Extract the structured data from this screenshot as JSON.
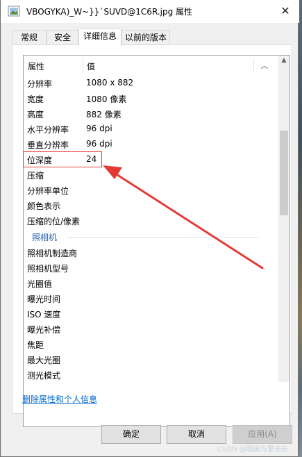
{
  "window": {
    "title": "VBOGYKA)_W~}}`SUVD@1C6R.jpg 属性",
    "close_glyph": "✕"
  },
  "tabs": [
    {
      "label": "常规",
      "active": false
    },
    {
      "label": "安全",
      "active": false
    },
    {
      "label": "详细信息",
      "active": true
    },
    {
      "label": "以前的版本",
      "active": false
    }
  ],
  "list": {
    "header": {
      "property": "属性",
      "value": "值"
    },
    "rows": [
      {
        "name": "分辨率",
        "value": "1080 x 882"
      },
      {
        "name": "宽度",
        "value": "1080 像素"
      },
      {
        "name": "高度",
        "value": "882 像素"
      },
      {
        "name": "水平分辨率",
        "value": "96 dpi"
      },
      {
        "name": "垂直分辨率",
        "value": "96 dpi"
      },
      {
        "name": "位深度",
        "value": "24"
      },
      {
        "name": "压缩",
        "value": ""
      },
      {
        "name": "分辨率单位",
        "value": ""
      },
      {
        "name": "颜色表示",
        "value": ""
      },
      {
        "name": "压缩的位/像素",
        "value": ""
      }
    ],
    "group": "照相机",
    "camera_rows": [
      {
        "name": "照相机制造商",
        "value": ""
      },
      {
        "name": "照相机型号",
        "value": ""
      },
      {
        "name": "光圈值",
        "value": ""
      },
      {
        "name": "曝光时间",
        "value": ""
      },
      {
        "name": "ISO 速度",
        "value": ""
      },
      {
        "name": "曝光补偿",
        "value": ""
      },
      {
        "name": "焦距",
        "value": ""
      },
      {
        "name": "最大光圈",
        "value": ""
      },
      {
        "name": "测光模式",
        "value": ""
      }
    ]
  },
  "remove_link": "删除属性和个人信息",
  "buttons": {
    "ok": "确定",
    "cancel": "取消",
    "apply": "应用(A)"
  },
  "watermark": "CSDN @踏破万里无云",
  "colors": {
    "annotation": "#e53935",
    "link": "#0066cc",
    "group": "#1e5aa8"
  }
}
